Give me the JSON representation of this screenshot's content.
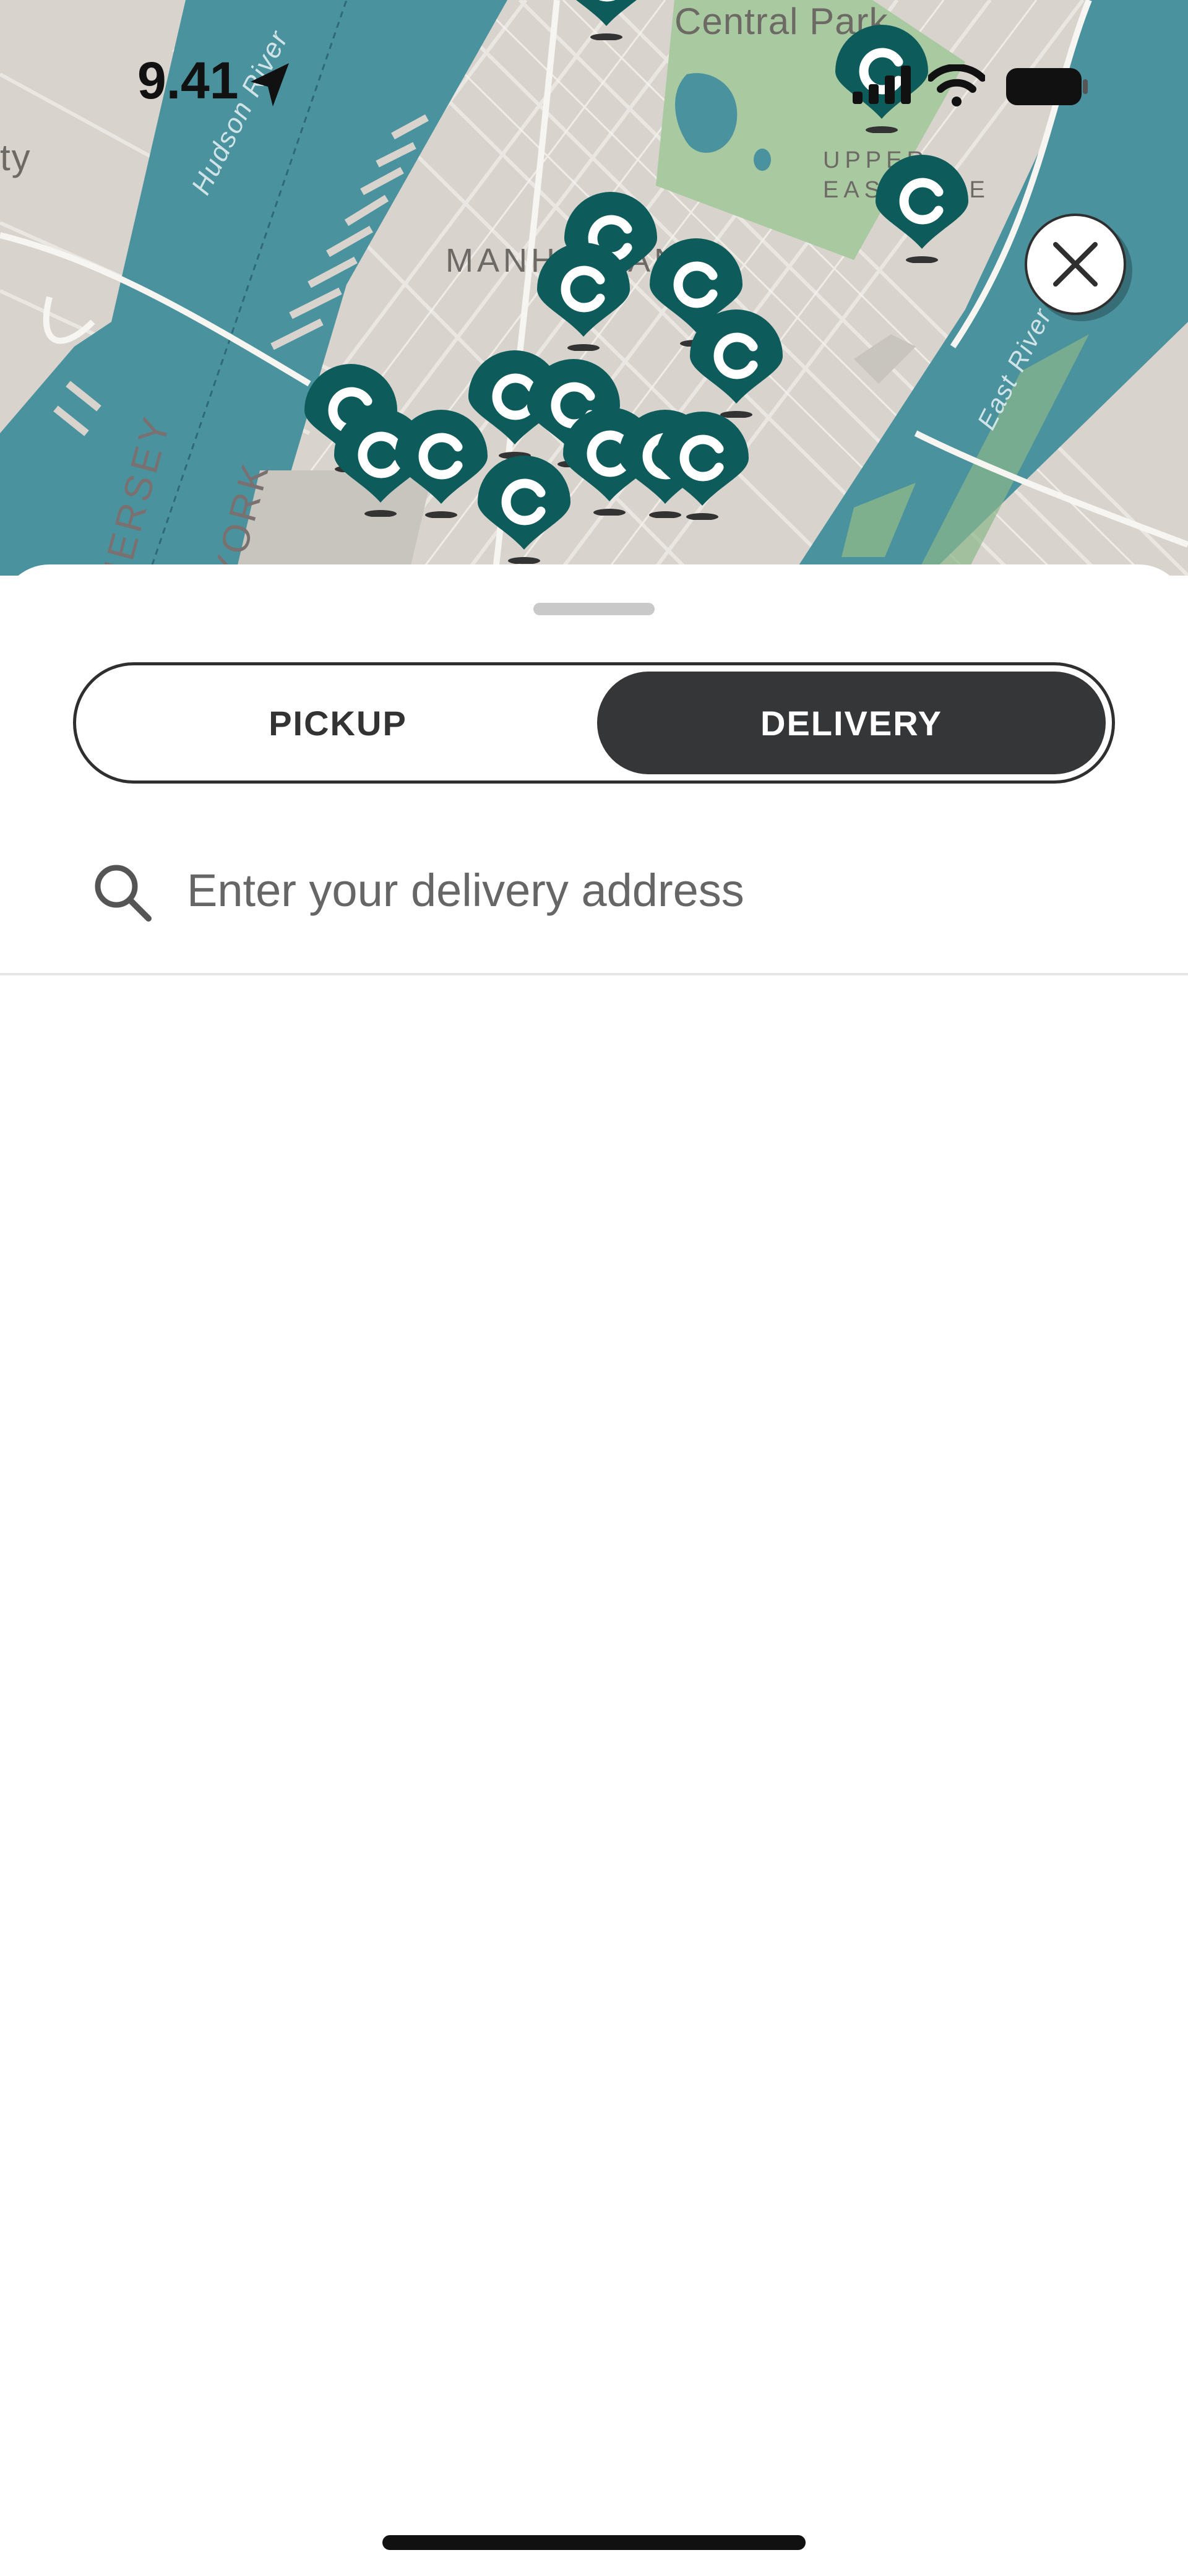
{
  "status_bar": {
    "time": "9.41",
    "icons": [
      "location-arrow-icon",
      "cellular-signal-icon",
      "wifi-icon",
      "battery-icon"
    ]
  },
  "map": {
    "labels": {
      "park": "Central Park",
      "borough": "MANHATTAN",
      "neighborhood": "UPPER EAST SIDE",
      "hudson": "Hudson River",
      "east_river": "East River",
      "jersey": "JERSEY",
      "york": "YORK",
      "city_partial": "ty"
    },
    "pin_icon": "store-location-pin-icon",
    "pin_letter": "C",
    "colors": {
      "land": "#d8d3cc",
      "water": "#4a929e",
      "park": "#a9c9a0",
      "pin": "#0d5b5a"
    }
  },
  "close_button": {
    "icon": "close-icon"
  },
  "sheet": {
    "mode_toggle": {
      "options": [
        {
          "label": "PICKUP",
          "selected": false
        },
        {
          "label": "DELIVERY",
          "selected": true
        }
      ]
    },
    "search": {
      "icon": "search-icon",
      "placeholder": "Enter your delivery address",
      "value": ""
    }
  }
}
